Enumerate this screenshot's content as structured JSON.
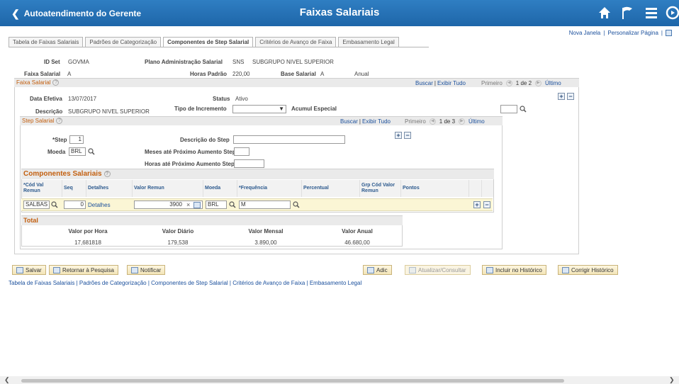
{
  "header": {
    "back_label": "Autoatendimento do Gerente",
    "title": "Faixas Salariais"
  },
  "toplinks": {
    "new_window": "Nova Janela",
    "personalize": "Personalizar Página"
  },
  "tabs": [
    "Tabela de Faixas Salariais",
    "Padrões de Categorização",
    "Componentes de Step Salarial",
    "Critérios de Avanço de Faixa",
    "Embasamento Legal"
  ],
  "info": {
    "idset_label": "ID Set",
    "idset_value": "GOVMA",
    "plano_label": "Plano Administração Salarial",
    "plano_value": "SNS",
    "plano_desc": "SUBGRUPO NIVEL SUPERIOR",
    "faixa_label": "Faixa Salarial",
    "faixa_value": "A",
    "horas_label": "Horas Padrão",
    "horas_value": "220,00",
    "base_label": "Base Salarial",
    "base_value": "A",
    "base_period": "Anual"
  },
  "faixa_section": {
    "title": "Faixa Salarial",
    "find": "Buscar",
    "sep": "|",
    "view_all": "Exibir Tudo",
    "first": "Primeiro",
    "position": "1 de 2",
    "last": "Último",
    "data_label": "Data Efetiva",
    "data_value": "13/07/2017",
    "status_label": "Status",
    "status_value": "Ativo",
    "desc_label": "Descrição",
    "desc_value": "SUBGRUPO NIVEL SUPERIOR",
    "tipo_label": "Tipo de Incremento",
    "tipo_value": "",
    "acumul_label": "Acumul Especial",
    "acumul_value": ""
  },
  "step_section": {
    "title": "Step Salarial",
    "find": "Buscar",
    "sep": "|",
    "view_all": "Exibir Tudo",
    "first": "Primeiro",
    "position": "1 de 3",
    "last": "Último",
    "step_label": "*Step",
    "step_value": "1",
    "desc_label": "Descrição do Step",
    "desc_value": "",
    "moeda_label": "Moeda",
    "moeda_value": "BRL",
    "meses_label": "Meses até Próximo Aumento Step",
    "meses_value": "",
    "horas_label": "Horas até Próximo Aumento Step",
    "horas_value": ""
  },
  "componentes": {
    "title": "Componentes Salariais",
    "columns": [
      "*Cód Val Remun",
      "Seq",
      "Detalhes",
      "Valor Remun",
      "Moeda",
      "*Frequência",
      "Percentual",
      "Grp Cód Valor Remun",
      "Pontos"
    ],
    "row": {
      "cod": "SALBAS",
      "seq": "0",
      "detalhes": "Detalhes",
      "valor": "3900",
      "moeda": "BRL",
      "freq": "M",
      "percentual": "",
      "grp": "",
      "pontos": ""
    }
  },
  "total": {
    "title": "Total",
    "headers": [
      "Valor por Hora",
      "Valor Diário",
      "Valor Mensal",
      "Valor Anual"
    ],
    "values": [
      "17,681818",
      "179,538",
      "3.890,00",
      "46.680,00"
    ]
  },
  "buttons": {
    "save": "Salvar",
    "return": "Retornar à Pesquisa",
    "notify": "Notificar",
    "add": "Adic",
    "update": "Atualizar/Consultar",
    "include": "Incluir no Histórico",
    "correct": "Corrigir Histórico"
  },
  "bottom_links": "Tabela de Faixas Salariais | Padrões de Categorização | Componentes de Step Salarial | Critérios de Avanço de Faixa | Embasamento Legal",
  "colors": {
    "header_blue": "#2370b5",
    "section_orange": "#c35f0f",
    "link_blue": "#1a4f9c",
    "row_yellow": "#fbf6d5"
  }
}
